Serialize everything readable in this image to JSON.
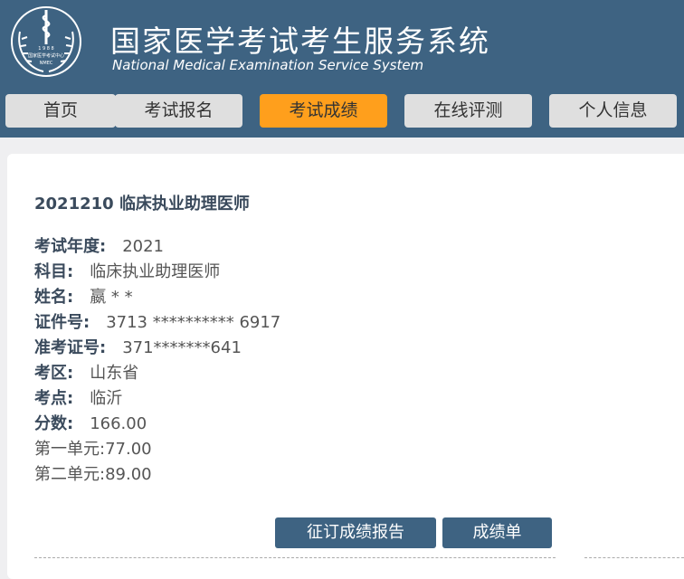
{
  "header": {
    "title_cn": "国家医学考试考生服务系统",
    "title_en": "National Medical Examination Service System",
    "logo_text_top": "1 9 8 8",
    "logo_text_mid": "国家医学考试中心",
    "logo_text_bottom": "NMEC"
  },
  "nav": {
    "items": [
      {
        "label": "首页"
      },
      {
        "label": "考试报名"
      },
      {
        "label": "考试成绩"
      },
      {
        "label": "在线评测"
      },
      {
        "label": "个人信息"
      }
    ],
    "active": "考试成绩"
  },
  "result": {
    "title": "2021210  临床执业助理医师",
    "fields": [
      {
        "label": "考试年度:",
        "value": "2021"
      },
      {
        "label": "科目:",
        "value": "临床执业助理医师"
      },
      {
        "label": "姓名:",
        "value": "嬴 * *"
      },
      {
        "label": "证件号:",
        "value": "3713 ********** 6917"
      },
      {
        "label": "准考证号:",
        "value": "371*******641"
      },
      {
        "label": "考区:",
        "value": "山东省"
      },
      {
        "label": "考点:",
        "value": "临沂"
      },
      {
        "label": "分数:",
        "value": "166.00"
      }
    ],
    "unit1": "第一单元:77.00",
    "unit2": "第二单元:89.00"
  },
  "buttons": {
    "order_report": "征订成绩报告",
    "score_sheet": "成绩单"
  },
  "colors": {
    "header_bg": "#3e6382",
    "nav_active": "#ff9f1c",
    "nav_inactive": "#dfdfdf",
    "button_bg": "#3e6382"
  }
}
